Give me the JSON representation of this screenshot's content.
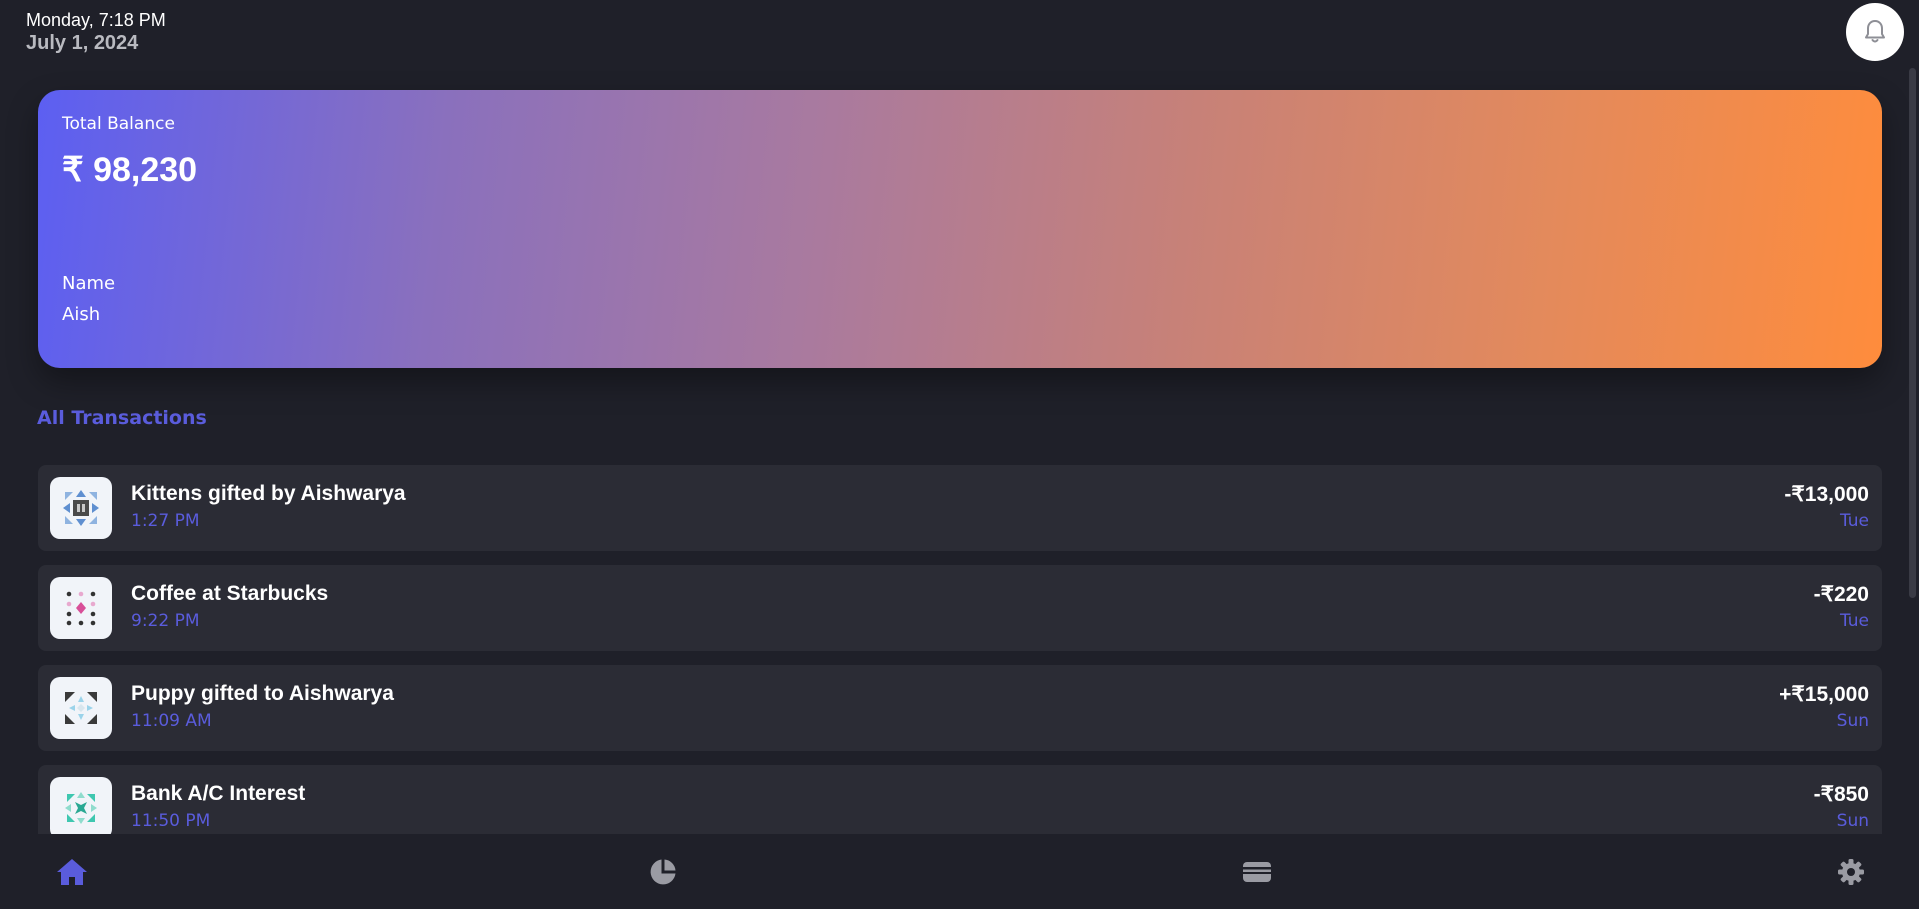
{
  "header": {
    "time": "Monday, 7:18 PM",
    "date": "July 1, 2024"
  },
  "icons": {
    "notifications": "bell-icon",
    "nav_home": "home-icon",
    "nav_analytics": "pie-chart-icon",
    "nav_cards": "card-icon",
    "nav_settings": "gear-icon"
  },
  "balance": {
    "label": "Total Balance",
    "amount": "₹ 98,230",
    "name_label": "Name",
    "name_value": "Aish"
  },
  "transactions_title": "All Transactions",
  "transactions": [
    {
      "title": "Kittens gifted by Aishwarya",
      "time": "1:27 PM",
      "amount": "-₹13,000",
      "day": "Tue"
    },
    {
      "title": "Coffee at Starbucks",
      "time": "9:22 PM",
      "amount": "-₹220",
      "day": "Tue"
    },
    {
      "title": "Puppy gifted to Aishwarya",
      "time": "11:09 AM",
      "amount": "+₹15,000",
      "day": "Sun"
    },
    {
      "title": "Bank A/C Interest",
      "time": "11:50 PM",
      "amount": "-₹850",
      "day": "Sun"
    }
  ],
  "colors": {
    "background": "#1f2029",
    "card": "#2b2c35",
    "accent": "#5a5cdc",
    "gradient_start": "#5c5ff2",
    "gradient_end": "#ff8c3c",
    "nav_inactive": "#9a9ba3"
  }
}
